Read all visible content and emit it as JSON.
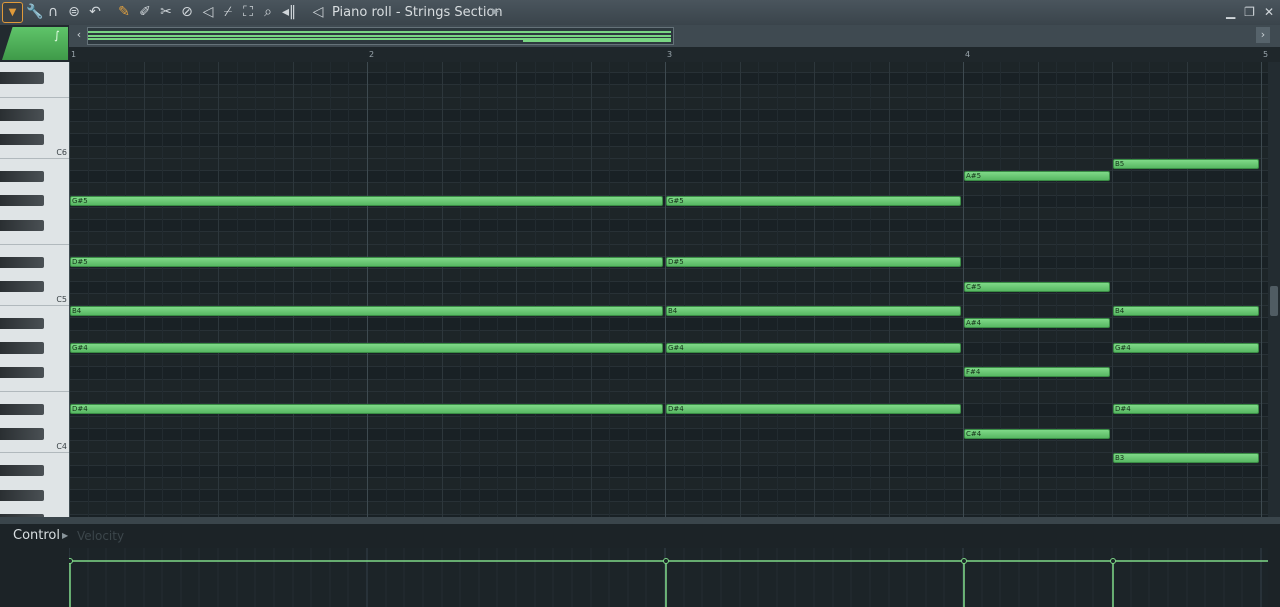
{
  "toolbar": {
    "title": "Piano roll - Strings Section",
    "icons": [
      "menu-arrow-icon",
      "wrench-icon",
      "magnet-icon",
      "playlist-icon",
      "undo-icon",
      "pencil-icon",
      "brush-icon",
      "delete-icon",
      "mute-icon",
      "slice-icon",
      "select-icon",
      "zoom-icon",
      "playback-icon",
      "speaker-icon"
    ]
  },
  "ruler": {
    "bars": [
      "1",
      "2",
      "3",
      "4",
      "5"
    ]
  },
  "keyboard": {
    "octave_labels": [
      "C6",
      "C5",
      "C4"
    ]
  },
  "notes": [
    {
      "label": "G#5",
      "start": 1,
      "end": 3
    },
    {
      "label": "G#5",
      "start": 3,
      "end": 4
    },
    {
      "label": "D#5",
      "start": 1,
      "end": 3
    },
    {
      "label": "D#5",
      "start": 3,
      "end": 4
    },
    {
      "label": "B4",
      "start": 1,
      "end": 3
    },
    {
      "label": "B4",
      "start": 3,
      "end": 4
    },
    {
      "label": "G#4",
      "start": 1,
      "end": 3
    },
    {
      "label": "G#4",
      "start": 3,
      "end": 4
    },
    {
      "label": "D#4",
      "start": 1,
      "end": 3
    },
    {
      "label": "D#4",
      "start": 3,
      "end": 4
    },
    {
      "label": "A#5",
      "start": 4,
      "end": 4.5
    },
    {
      "label": "C#5",
      "start": 4,
      "end": 4.5
    },
    {
      "label": "A#4",
      "start": 4,
      "end": 4.5
    },
    {
      "label": "F#4",
      "start": 4,
      "end": 4.5
    },
    {
      "label": "C#4",
      "start": 4,
      "end": 4.5
    },
    {
      "label": "B5",
      "start": 4.5,
      "end": 5
    },
    {
      "label": "B4",
      "start": 4.5,
      "end": 5
    },
    {
      "label": "G#4",
      "start": 4.5,
      "end": 5
    },
    {
      "label": "D#4",
      "start": 4.5,
      "end": 5
    },
    {
      "label": "B3",
      "start": 4.5,
      "end": 5
    }
  ],
  "control": {
    "label": "Control",
    "parameter": "Velocity",
    "velocity_events": [
      1,
      3,
      4,
      4.5
    ]
  },
  "colors": {
    "note": "#6fcf7a",
    "accent": "#e09a3a",
    "grid_bg": "#1d2528"
  }
}
